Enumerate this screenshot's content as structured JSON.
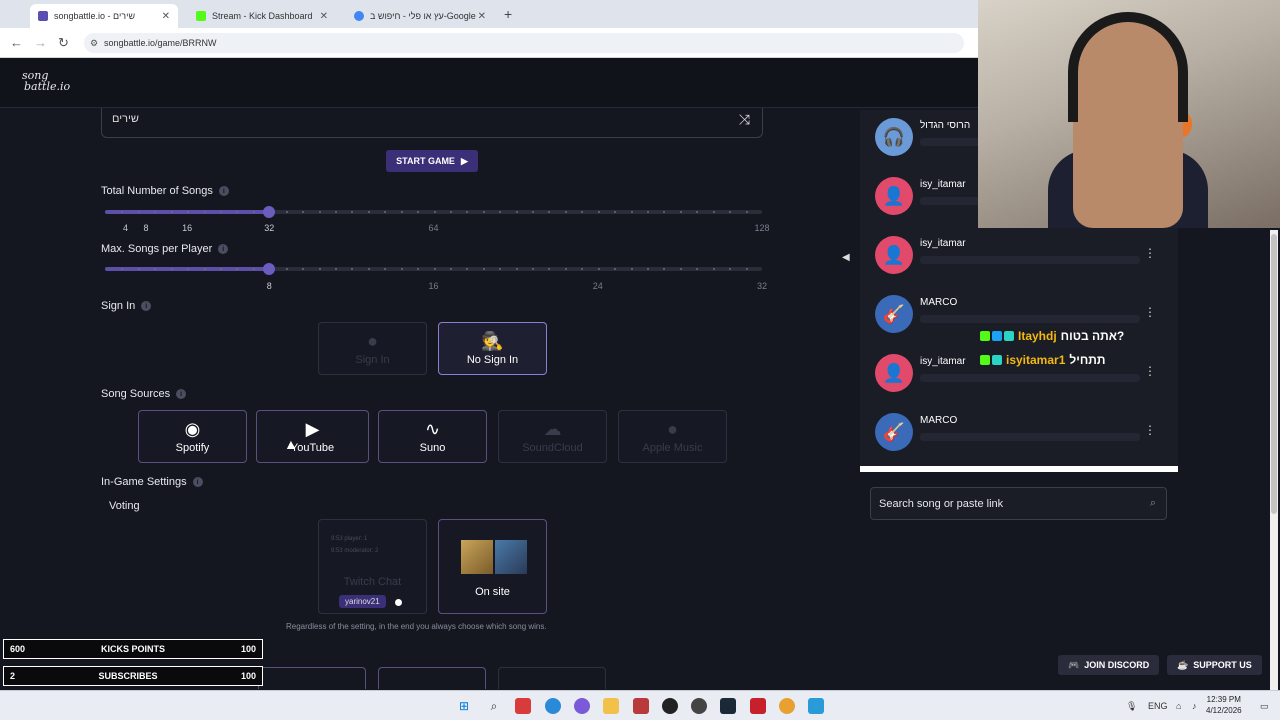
{
  "browser": {
    "tabs": [
      {
        "label": "songbattle.io - שירים",
        "active": true,
        "color": "#5a4fb0"
      },
      {
        "label": "Stream - Kick Dashboard",
        "active": false,
        "color": "#53fc18"
      },
      {
        "label": "עץ או פלי - חיפוש ב-Google",
        "active": false,
        "color": "#4285f4"
      }
    ],
    "new_tab": "+",
    "url": "songbattle.io/game/BRRNW"
  },
  "site": {
    "logo_line1": "song",
    "logo_line2": "battle.io"
  },
  "game": {
    "genre_value": "שירים",
    "start_label": "START GAME",
    "total_songs_label": "Total Number of Songs",
    "total_songs_value": 32,
    "total_songs_max": 128,
    "total_ticks": [
      "4",
      "8",
      "16",
      "32",
      "64",
      "128"
    ],
    "max_per_player_label": "Max. Songs per Player",
    "max_per_player_value": 8,
    "max_per_player_max": 32,
    "per_player_ticks": [
      "8",
      "16",
      "24",
      "32"
    ],
    "sign_in_label": "Sign In",
    "sign_in_options": [
      {
        "label": "Sign In",
        "enabled": false
      },
      {
        "label": "No Sign In",
        "enabled": true,
        "selected": true
      }
    ],
    "song_sources_label": "Song Sources",
    "sources": [
      {
        "label": "Spotify",
        "enabled": true
      },
      {
        "label": "YouTube",
        "enabled": true
      },
      {
        "label": "Suno",
        "enabled": true
      },
      {
        "label": "SoundCloud",
        "enabled": false
      },
      {
        "label": "Apple Music",
        "enabled": false
      }
    ],
    "in_game_label": "In-Game Settings",
    "voting_label": "Voting",
    "voting_twitch_label": "Twitch Chat",
    "voting_twitch_line1": "9:53 player: 1",
    "voting_twitch_line2": "9:53 moderator: 2",
    "voting_twitch_user": "yarinov21",
    "voting_onsite_label": "On site",
    "voting_note": "Regardless of the setting, in the end you always choose which song wins."
  },
  "kick_overlay": [
    {
      "left": "600",
      "label": "KICKS POINTS",
      "right": "100"
    },
    {
      "left": "2",
      "label": "SUBSCRIBES",
      "right": "100"
    }
  ],
  "playlist": [
    {
      "name": "הרוסי הגדול",
      "avatar": "headphones"
    },
    {
      "name": "isy_itamar",
      "avatar": "user"
    },
    {
      "name": "isy_itamar",
      "avatar": "user"
    },
    {
      "name": "MARCO",
      "avatar": "guitar"
    },
    {
      "name": "isy_itamar",
      "avatar": "user"
    },
    {
      "name": "MARCO",
      "avatar": "guitar"
    }
  ],
  "chat_messages": [
    {
      "user": "Itayhdj",
      "text": "אתה בטוח?"
    },
    {
      "user": "isyitamar1",
      "text": "תתחיל"
    }
  ],
  "search": {
    "placeholder": "Search song or paste link"
  },
  "footer_buttons": {
    "discord": "JOIN DISCORD",
    "support": "SUPPORT US"
  },
  "taskbar": {
    "lang": "ENG",
    "time": "12:39 PM",
    "date": "4/12/2026"
  },
  "colors": {
    "accent": "#5b4fa8",
    "kick_green": "#53fc18",
    "discord": "#5865f2"
  }
}
